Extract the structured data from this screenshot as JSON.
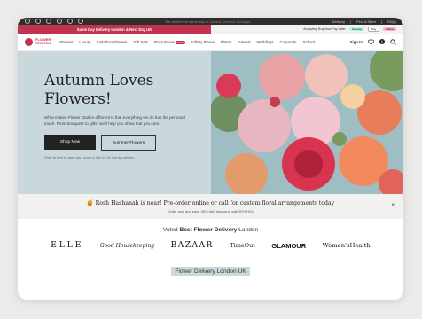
{
  "topbar": {
    "message": "We deliver the same day in London, even on Sundays",
    "links": [
      "Delivery",
      "Find A Store",
      "FAQs"
    ]
  },
  "promo": {
    "left_text": "Same Day Delivery London & Next Day UK",
    "right_text": "Accepting Buy Now Pay Later",
    "payment_options": [
      "clearpay",
      "Pay",
      "Klarna"
    ]
  },
  "nav": {
    "logo_line1": "FLOWER",
    "logo_line2": "STATION",
    "items": [
      "Flowers",
      "Luxury",
      "Letterbox Flowers",
      "Gift Sets",
      "Rose Boxes",
      "Infinity Roses",
      "Plants",
      "Funeral",
      "Weddings",
      "Corporate",
      "School"
    ],
    "new_badge": "NEW",
    "sign_in": "Sign In",
    "basket_count": "0"
  },
  "hero": {
    "title_line1": "Autumn Loves",
    "title_line2": "Flowers!",
    "body": "What makes Flower Station different is that everything we do has the personal touch. From bouquets to gifts, we'll help you show that you care.",
    "primary_button": "Shop Now",
    "secondary_button": "Summer Flowers",
    "small_print": "Order by 5pm for same day London & 3pm for UK next day delivery."
  },
  "notice": {
    "emoji": "🍯",
    "text_a": "Rosh Hashanah is near! ",
    "link_a": "Pre-order",
    "text_b": " online or ",
    "link_b": "call",
    "text_c": " for custom floral arrangements today",
    "subtext": "Order now and save 30% with discount code ROSH24",
    "close": "×"
  },
  "press": {
    "heading_prefix": "Voted ",
    "heading_bold": "Best Flower Delivery",
    "heading_suffix": " London",
    "logos": [
      "ELLE",
      "Good Housekeeping",
      "BAZAAR",
      "TimeOut",
      "GLAMOUR",
      "Women'sHealth"
    ]
  },
  "footer_tag": "Flower Delivery London UK",
  "colors": {
    "brand": "#c2334f",
    "hero_bg": "#c9d8dd"
  }
}
